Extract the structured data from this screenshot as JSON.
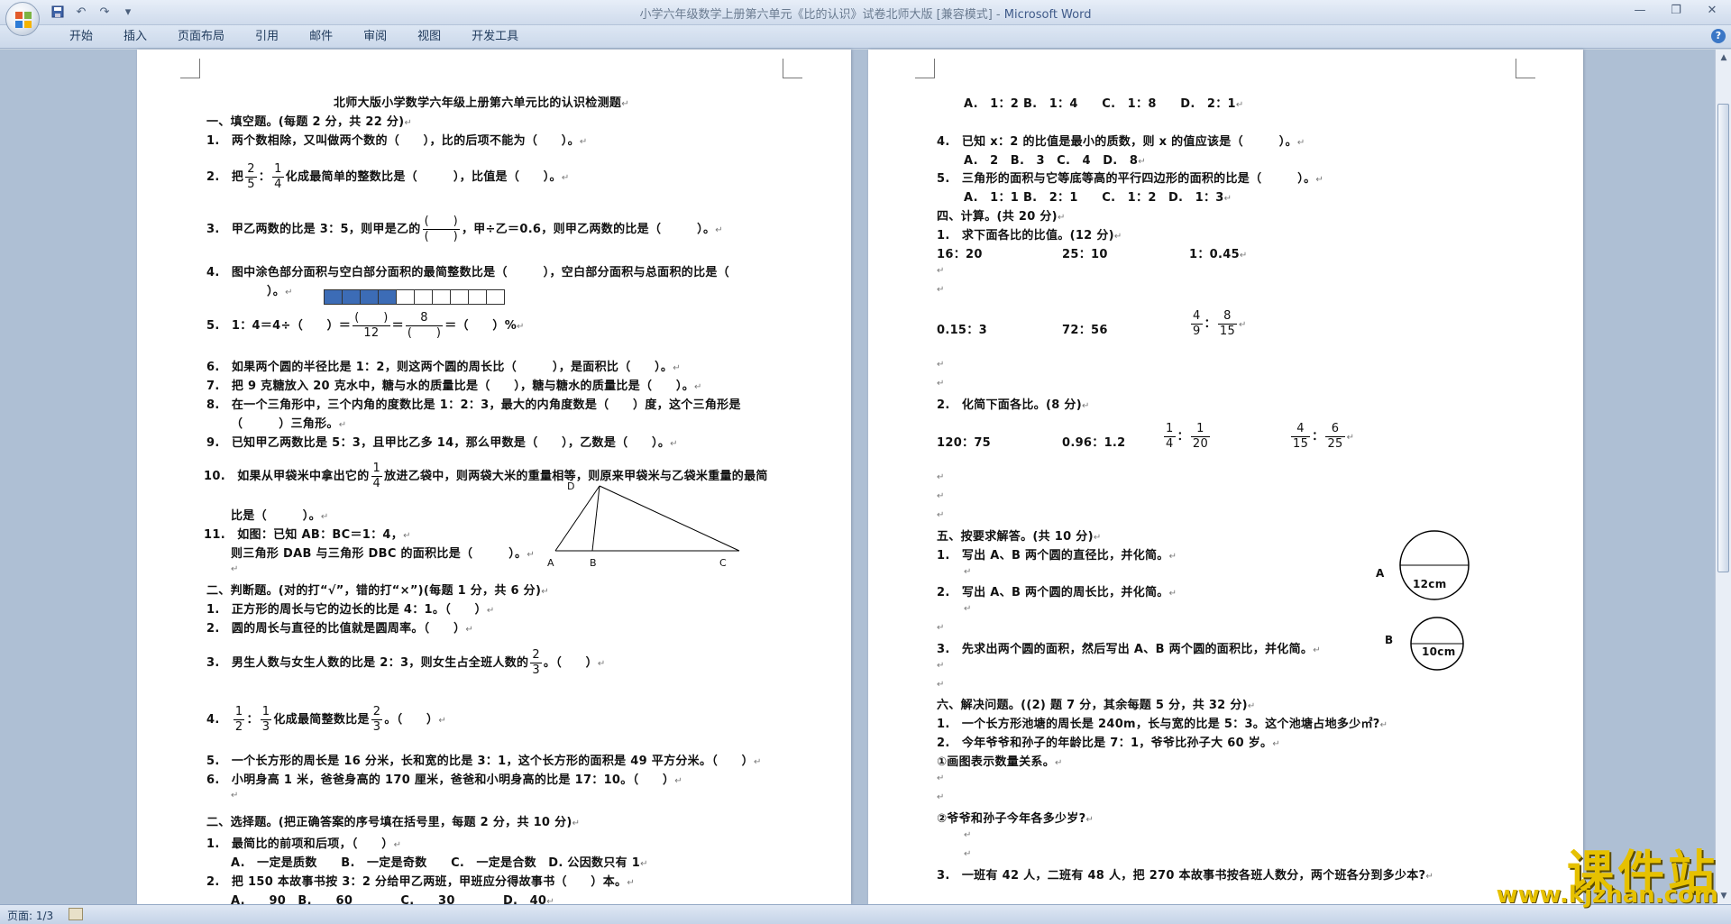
{
  "titlebar": {
    "title": "小学六年级数学上册第六单元《比的认识》试卷北师大版 [兼容模式]",
    "separator": "-",
    "app": "Microsoft Word"
  },
  "qat": {
    "save_icon": "save-icon",
    "undo_icon": "undo-icon",
    "redo_icon": "redo-icon",
    "customize_icon": "customize-icon"
  },
  "tabs": [
    "开始",
    "插入",
    "页面布局",
    "引用",
    "邮件",
    "审阅",
    "视图",
    "开发工具"
  ],
  "status": {
    "page": "页面: 1/3"
  },
  "watermark": {
    "text": "课件站",
    "url": "www.kjzhan.com"
  },
  "page1": {
    "title": "北师大版小学数学六年级上册第六单元比的认识检测题",
    "s1": "一、填空题。(每题 2 分，共 22 分)",
    "q1": "1.　两个数相除，又叫做两个数的（　　），比的后项不能为（　　）。",
    "q2a": "2.　把",
    "q2f1n": "2",
    "q2f1d": "5",
    "q2colon": "：",
    "q2f2n": "1",
    "q2f2d": "4",
    "q2b": "化成最简单的整数比是（　　　），比值是（　　）。",
    "q3a": "3.　甲乙两数的比是 3：5，则甲是乙的",
    "q3fn": "(　　)",
    "q3fd": "(　　)",
    "q3b": "，甲÷乙＝0.6，则甲乙两数的比是（　　　）。",
    "q4": "4.　图中涂色部分面积与空白部分面积的最简整数比是（　　　），空白部分面积与总面积的比是（",
    "q4b": "）。",
    "q5a": "5.　1：4＝4÷（　　）＝",
    "q5f1n": "(　　)",
    "q5f1d": "12",
    "q5eq": "＝",
    "q5f2n": "8",
    "q5f2d": "(　　)",
    "q5b": "＝（　　）%",
    "q6": "6.　如果两个圆的半径比是 1：2，则这两个圆的周长比（　　　），是面积比（　　）。",
    "q7": "7.　把 9 克糖放入 20 克水中，糖与水的质量比是（　　），糖与糖水的质量比是（　　）。",
    "q8": "8.　在一个三角形中，三个内角的度数比是 1：2：3，最大的内角度数是（　　）度，这个三角形是",
    "q8b": "（　　　）三角形。",
    "q9": "9.　已知甲乙两数比是 5：3，且甲比乙多 14，那么甲数是（　　），乙数是（　　）。",
    "q10a": "10.　如果从甲袋米中拿出它的",
    "q10fn": "1",
    "q10fd": "4",
    "q10b": "放进乙袋中，则两袋大米的重量相等，则原来甲袋米与乙袋米重量的最简",
    "q10c": "比是（　　　）。",
    "q11": "11.　如图：已知 AB：BC＝1：4，",
    "q11b": "则三角形 DAB 与三角形 DBC 的面积比是（　　　）。",
    "tri": {
      "A": "A",
      "B": "B",
      "C": "C",
      "D": "D"
    },
    "s2": "二、判断题。(对的打“√”，错的打“×”)(每题 1 分，共 6 分)",
    "j1": "1.　正方形的周长与它的边长的比是 4：1。（　　）",
    "j2": "2.　圆的周长与直径的比值就是圆周率。（　　）",
    "j3a": "3.　男生人数与女生人数的比是 2：3，则女生占全班人数的",
    "j3fn": "2",
    "j3fd": "3",
    "j3b": "。（　　）",
    "j4a": "4.",
    "j4f1n": "1",
    "j4f1d": "2",
    "j4colon": "：",
    "j4f2n": "1",
    "j4f2d": "3",
    "j4b": "化成最简整数比是",
    "j4f3n": "2",
    "j4f3d": "3",
    "j4c": "。（　　）",
    "j5": "5.　一个长方形的周长是 16 分米，长和宽的比是 3：1，这个长方形的面积是 49 平方分米。（　　）",
    "j6": "6.　小明身高 1 米，爸爸身高的 170 厘米，爸爸和小明身高的比是 17：10。（　　）",
    "s3": "二、选择题。(把正确答案的序号填在括号里，每题 2 分，共 10 分)",
    "c1": "1.　最简比的前项和后项，（　　）",
    "c1o": "A.　一定是质数　　B.　一定是奇数　　C.　一定是合数　D. 公因数只有 1",
    "c2": "2.　把 150 本故事书按 3：2 分给甲乙两班，甲班应分得故事书（　　）本。",
    "c2o": "A.　　90　B.　　60　　　　C.　　30　　　　D.　40"
  },
  "page2": {
    "c3o": "A.　1：2 B.　1：4　　C.　1：8　　D.　2：1",
    "c4": "4.　已知 x：2 的比值是最小的质数，则 x 的值应该是（　　　）。",
    "c4o": "A.　2　B.　3　C.　4　D.　8",
    "c5": "5.　三角形的面积与它等底等高的平行四边形的面积的比是（　　　）。",
    "c5o": "A.　1：1 B.　2：1　　C.　1：2　D.　1：3",
    "s4": "四、计算。(共 20 分)",
    "k1": "1.　求下面各比的比值。(12 分)",
    "k1a": "16：20",
    "k1b": "25：10",
    "k1c": "1：0.45",
    "k1d": "0.15：3",
    "k1e": "72：56",
    "k1ffn": "4",
    "k1ffd": "9",
    "k1fcolon": "：",
    "k1fgn": "8",
    "k1fgd": "15",
    "k2": "2.　化简下面各比。(8 分)",
    "k2a": "120：75",
    "k2b": "0.96：1.2",
    "k2c1n": "1",
    "k2c1d": "4",
    "k2ccolon": "：",
    "k2c2n": "1",
    "k2c2d": "20",
    "k2d1n": "4",
    "k2d1d": "15",
    "k2dcolon": "：",
    "k2d2n": "6",
    "k2d2d": "25",
    "s5": "五、按要求解答。(共 10 分)",
    "r1": "1.　写出 A、B 两个圆的直径比，并化简。",
    "r2": "2.　写出 A、B 两个圆的周长比，并化简。",
    "r3": "3.　先求出两个圆的面积，然后写出 A、B 两个圆的面积比，并化简。",
    "circleA": {
      "label": "A",
      "measure": "12cm"
    },
    "circleB": {
      "label": "B",
      "measure": "10cm"
    },
    "s6": "六、解决问题。((2) 题 7 分，其余每题 5 分，共 32 分)",
    "p1": "1.　一个长方形池塘的周长是 240m，长与宽的比是 5：3。这个池塘占地多少㎡?",
    "p2": "2.　今年爷爷和孙子的年龄比是 7：1，爷爷比孙子大 60 岁。",
    "p2a": "①画图表示数量关系。",
    "p2b": "②爷爷和孙子今年各多少岁?",
    "p3": "3.　一班有 42 人，二班有 48 人，把 270 本故事书按各班人数分，两个班各分到多少本?"
  },
  "pm": "↵"
}
